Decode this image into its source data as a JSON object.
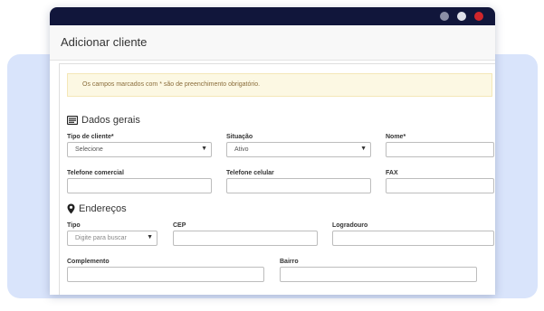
{
  "window": {
    "title": "Adicionar cliente"
  },
  "notice": "Os campos marcados com * são de preenchimento obrigatório.",
  "dados_gerais": {
    "heading": "Dados gerais",
    "icon": "id-card-icon",
    "tipo_cliente": {
      "label": "Tipo de cliente*",
      "value": "Selecione"
    },
    "situacao": {
      "label": "Situação",
      "value": "Ativo"
    },
    "nome": {
      "label": "Nome*",
      "value": ""
    },
    "telefone_comercial": {
      "label": "Telefone comercial",
      "value": ""
    },
    "telefone_celular": {
      "label": "Telefone celular",
      "value": ""
    },
    "fax": {
      "label": "FAX",
      "value": ""
    }
  },
  "enderecos": {
    "heading": "Endereços",
    "icon": "map-pin-icon",
    "tipo": {
      "label": "Tipo",
      "placeholder": "Digite para buscar"
    },
    "cep": {
      "label": "CEP",
      "value": ""
    },
    "logradouro": {
      "label": "Logradouro",
      "value": ""
    },
    "complemento": {
      "label": "Complemento",
      "value": ""
    },
    "bairro": {
      "label": "Bairro",
      "value": ""
    }
  },
  "colors": {
    "titlebar": "#11163b",
    "notice_bg": "#fcf8e3",
    "close_dot": "#d0262b"
  }
}
